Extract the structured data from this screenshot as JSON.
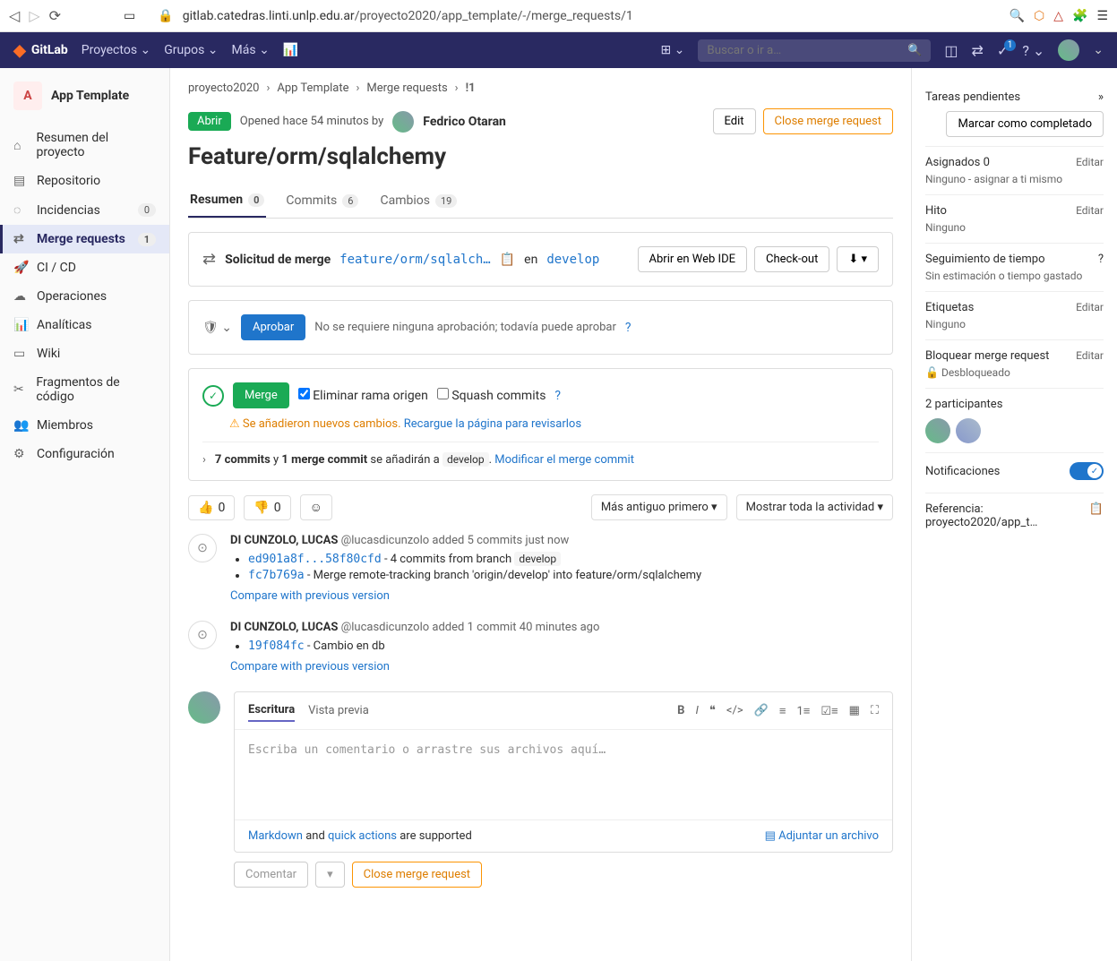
{
  "browser": {
    "url_host": "gitlab.catedras.linti.unlp.edu.ar",
    "url_path": "/proyecto2020/app_template/-/merge_requests/1"
  },
  "topbar": {
    "brand": "GitLab",
    "links": [
      "Proyectos",
      "Grupos",
      "Más"
    ],
    "search_placeholder": "Buscar o ir a…",
    "todo_count": "1"
  },
  "sidebar": {
    "project_letter": "A",
    "project_name": "App Template",
    "items": [
      {
        "label": "Resumen del proyecto",
        "icon": "⌂"
      },
      {
        "label": "Repositorio",
        "icon": "▤"
      },
      {
        "label": "Incidencias",
        "icon": "◌",
        "count": "0"
      },
      {
        "label": "Merge requests",
        "icon": "⇄",
        "count": "1",
        "active": true
      },
      {
        "label": "CI / CD",
        "icon": "🚀"
      },
      {
        "label": "Operaciones",
        "icon": "☁"
      },
      {
        "label": "Analíticas",
        "icon": "📊"
      },
      {
        "label": "Wiki",
        "icon": "▭"
      },
      {
        "label": "Fragmentos de código",
        "icon": "✂"
      },
      {
        "label": "Miembros",
        "icon": "👥"
      },
      {
        "label": "Configuración",
        "icon": "⚙"
      }
    ]
  },
  "breadcrumb": [
    "proyecto2020",
    "App Template",
    "Merge requests",
    "!1"
  ],
  "mr": {
    "status": "Abrir",
    "meta": "Opened hace 54 minutos by",
    "author": "Fedrico Otaran",
    "edit": "Edit",
    "close": "Close merge request",
    "title": "Feature/orm/sqlalchemy"
  },
  "tabs": [
    {
      "label": "Resumen",
      "count": "0",
      "active": true
    },
    {
      "label": "Commits",
      "count": "6"
    },
    {
      "label": "Cambios",
      "count": "19"
    }
  ],
  "request_panel": {
    "label": "Solicitud de merge",
    "source": "feature/orm/sqlalch…",
    "into": "en",
    "target": "develop",
    "webide": "Abrir en Web IDE",
    "checkout": "Check-out"
  },
  "approve_panel": {
    "btn": "Aprobar",
    "text": "No se requiere ninguna aprobación; todavía puede aprobar"
  },
  "merge_panel": {
    "btn": "Merge",
    "delete_source": "Eliminar rama origen",
    "squash": "Squash commits",
    "new_changes": "Se añadieron nuevos cambios.",
    "reload": "Recargue la página para revisarlos",
    "summary_pre": "7 commits",
    "summary_and": "y",
    "summary_mc": "1 merge commit",
    "summary_post": "se añadirán a",
    "summary_branch": "develop",
    "modify": "Modificar el merge commit"
  },
  "reactions": {
    "thumbs_up": "0",
    "thumbs_down": "0"
  },
  "sort": {
    "oldest": "Más antiguo primero",
    "activity": "Mostrar toda la actividad"
  },
  "timeline": [
    {
      "author": "DI CUNZOLO, LUCAS",
      "handle": "@lucasdicunzolo",
      "action": "added 5 commits just now",
      "commits": [
        {
          "sha": "ed901a8f...58f80cfd",
          "msg": "- 4 commits from branch",
          "branch": "develop"
        },
        {
          "sha": "fc7b769a",
          "msg": "- Merge remote-tracking branch 'origin/develop' into feature/orm/sqlalchemy"
        }
      ],
      "compare": "Compare with previous version"
    },
    {
      "author": "DI CUNZOLO, LUCAS",
      "handle": "@lucasdicunzolo",
      "action": "added 1 commit 40 minutes ago",
      "commits": [
        {
          "sha": "19f084fc",
          "msg": "- Cambio en db"
        }
      ],
      "compare": "Compare with previous version"
    }
  ],
  "comment": {
    "write": "Escritura",
    "preview": "Vista previa",
    "placeholder": "Escriba un comentario o arrastre sus archivos aquí…",
    "markdown": "Markdown",
    "and": "and",
    "quick": "quick actions",
    "supported": "are supported",
    "attach": "Adjuntar un archivo",
    "submit": "Comentar",
    "close": "Close merge request"
  },
  "rightbar": {
    "todo_label": "Tareas pendientes",
    "todo_btn": "Marcar como completado",
    "assignees_label": "Asignados 0",
    "assignees_val": "Ninguno - asignar a ti mismo",
    "milestone_label": "Hito",
    "milestone_val": "Ninguno",
    "time_label": "Seguimiento de tiempo",
    "time_val": "Sin estimación o tiempo gastado",
    "labels_label": "Etiquetas",
    "labels_val": "Ninguno",
    "lock_label": "Bloquear merge request",
    "lock_val": "Desbloqueado",
    "participants": "2 participantes",
    "notifications": "Notificaciones",
    "reference_label": "Referencia:",
    "reference_val": "proyecto2020/app_t…",
    "edit": "Editar"
  }
}
